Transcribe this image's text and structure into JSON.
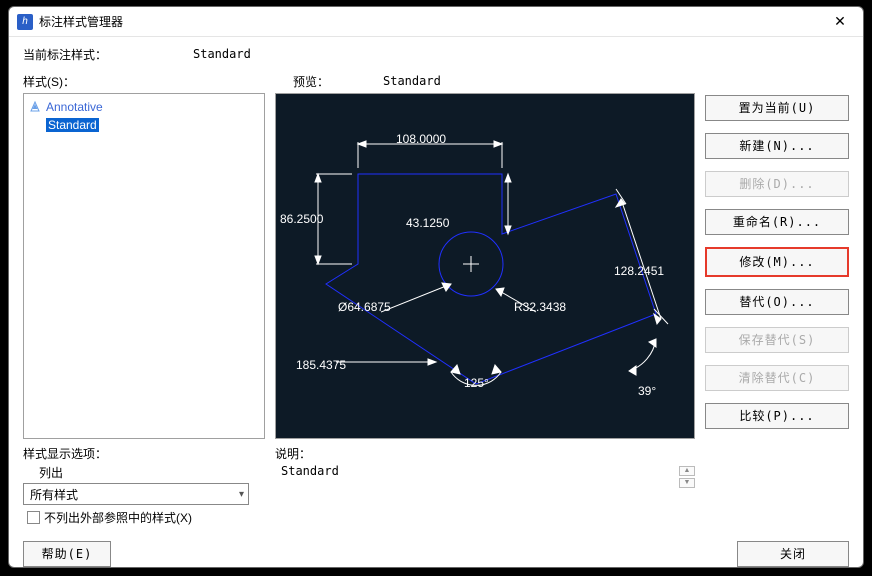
{
  "title": "标注样式管理器",
  "current_style_label": "当前标注样式：",
  "current_style_value": "Standard",
  "styles_label": "样式(S)：",
  "preview_label": "预览：",
  "preview_value": "Standard",
  "styles": {
    "item0": "Annotative",
    "item1": "Standard"
  },
  "buttons": {
    "set_current": "置为当前(U)",
    "new": "新建(N)...",
    "delete": "删除(D)...",
    "rename": "重命名(R)...",
    "modify": "修改(M)...",
    "override": "替代(O)...",
    "save_override": "保存替代(S)",
    "clear_override": "清除替代(C)",
    "compare": "比较(P)..."
  },
  "display_opts_label": "样式显示选项：",
  "list_label": "列出",
  "select_value": "所有样式",
  "chk_label": "不列出外部参照中的样式(X)",
  "desc_label": "说明：",
  "desc_value": "Standard",
  "help_btn": "帮助(E)",
  "close_btn": "关闭",
  "dims": {
    "d108": "108.0000",
    "d86": "86.2500",
    "d43": "43.1250",
    "d128": "128.2451",
    "d64": "Ø64.6875",
    "r32": "R32.3438",
    "d185": "185.4375",
    "d125": "125°",
    "d39": "39°"
  }
}
